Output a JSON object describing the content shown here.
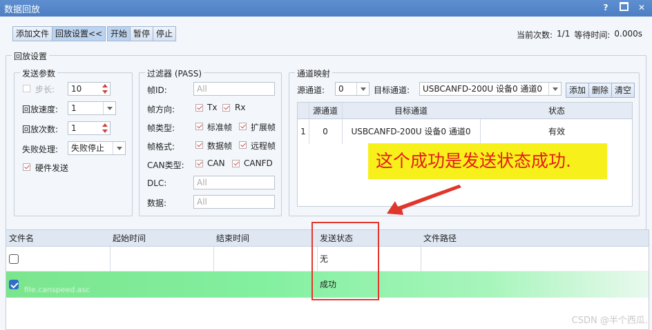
{
  "window": {
    "title": "数据回放",
    "help": "?",
    "close": "✕"
  },
  "toolbar": {
    "add_file": "添加文件",
    "replay_settings": "回放设置<<",
    "start": "开始",
    "pause": "暂停",
    "stop": "停止"
  },
  "status": {
    "current_count_label": "当前次数:",
    "current_count_value": "1/1",
    "wait_label": "等待时间:",
    "wait_value": "0.000s"
  },
  "replay_settings": {
    "legend": "回放设置",
    "send_params": {
      "legend": "发送参数",
      "step_label": "步长:",
      "step_value": "10",
      "step_checked": false,
      "speed_label": "回放速度:",
      "speed_value": "1",
      "count_label": "回放次数:",
      "count_value": "1",
      "fail_label": "失败处理:",
      "fail_value": "失败停止",
      "hardware_send_label": "硬件发送",
      "hardware_send_checked": true
    },
    "filter": {
      "legend": "过滤器 (PASS)",
      "frame_id_label": "帧ID:",
      "frame_id_placeholder": "All",
      "direction_label": "帧方向:",
      "tx_label": "Tx",
      "rx_label": "Rx",
      "type_label": "帧类型:",
      "std_label": "标准帧",
      "ext_label": "扩展帧",
      "format_label": "帧格式:",
      "data_label": "数据帧",
      "remote_label": "远程帧",
      "can_type_label": "CAN类型:",
      "can_label": "CAN",
      "canfd_label": "CANFD",
      "dlc_label": "DLC:",
      "dlc_placeholder": "All",
      "payload_label": "数据:",
      "payload_placeholder": "All"
    },
    "channel_map": {
      "legend": "通道映射",
      "src_label": "源通道:",
      "src_value": "0",
      "dst_label": "目标通道:",
      "dst_value": "USBCANFD-200U 设备0 通道0",
      "add": "添加",
      "delete": "删除",
      "clear": "清空",
      "columns": [
        "源通道",
        "目标通道",
        "状态"
      ],
      "rows": [
        {
          "index": "1",
          "src": "0",
          "dst": "USBCANFD-200U 设备0 通道0",
          "state": "有效"
        }
      ]
    }
  },
  "annotation": {
    "callout": "这个成功是发送状态成功."
  },
  "file_list": {
    "columns": [
      "文件名",
      "起始时间",
      "结束时间",
      "发送状态",
      "文件路径"
    ],
    "rows": [
      {
        "checked": false,
        "state": "无"
      },
      {
        "checked": true,
        "state": "成功",
        "name_fragment": "file.canspeed.asc"
      }
    ]
  },
  "watermark": "CSDN @半个西瓜."
}
